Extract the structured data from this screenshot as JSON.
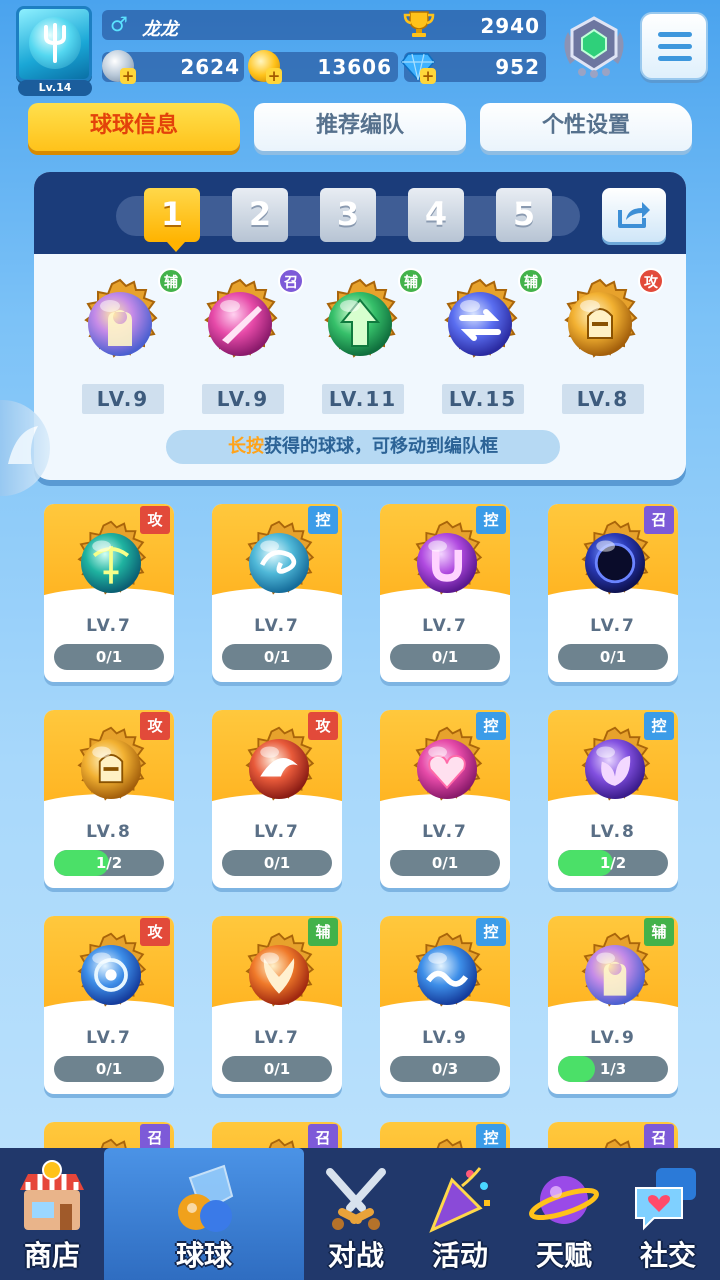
{
  "player": {
    "level": "Lv.14",
    "gender_symbol": "♂",
    "name": "龙龙",
    "trophies": "2940",
    "silver": "2624",
    "gold": "13606",
    "gems": "952"
  },
  "tabs": [
    "球球信息",
    "推荐编队",
    "个性设置"
  ],
  "team": {
    "slots": [
      "1",
      "2",
      "3",
      "4",
      "5"
    ],
    "selected_slot": "1",
    "balls": [
      {
        "level": "LV.9",
        "tag": "辅",
        "icon": "support-figure-ball"
      },
      {
        "level": "LV.9",
        "tag": "召",
        "icon": "pink-blade-ball"
      },
      {
        "level": "LV.11",
        "tag": "辅",
        "icon": "green-arrow-ball"
      },
      {
        "level": "LV.15",
        "tag": "辅",
        "icon": "blue-swap-ball"
      },
      {
        "level": "LV.8",
        "tag": "攻",
        "icon": "golden-knight-ball"
      }
    ],
    "hint_highlight": "长按",
    "hint_text": "获得的球球，可移动到编队框"
  },
  "cards": [
    {
      "level": "LV.7",
      "progress": "0/1",
      "fraction": 0,
      "tag": "攻",
      "icon": "green-crossbow-ball"
    },
    {
      "level": "LV.7",
      "progress": "0/1",
      "fraction": 0,
      "tag": "控",
      "icon": "cyan-swirl-ball"
    },
    {
      "level": "LV.7",
      "progress": "0/1",
      "fraction": 0,
      "tag": "控",
      "icon": "purple-magnet-ball"
    },
    {
      "level": "LV.7",
      "progress": "0/1",
      "fraction": 0,
      "tag": "召",
      "icon": "dark-portal-ball"
    },
    {
      "level": "LV.8",
      "progress": "1/2",
      "fraction": 0.5,
      "tag": "攻",
      "icon": "golden-knight-ball"
    },
    {
      "level": "LV.7",
      "progress": "0/1",
      "fraction": 0,
      "tag": "攻",
      "icon": "red-dolphin-ball"
    },
    {
      "level": "LV.7",
      "progress": "0/1",
      "fraction": 0,
      "tag": "控",
      "icon": "pink-heart-ball"
    },
    {
      "level": "LV.8",
      "progress": "1/2",
      "fraction": 0.5,
      "tag": "控",
      "icon": "purple-butterfly-ball"
    },
    {
      "level": "LV.7",
      "progress": "0/1",
      "fraction": 0,
      "tag": "攻",
      "icon": "blue-vortex-ball"
    },
    {
      "level": "LV.7",
      "progress": "0/1",
      "fraction": 0,
      "tag": "辅",
      "icon": "red-phoenix-ball"
    },
    {
      "level": "LV.9",
      "progress": "0/3",
      "fraction": 0,
      "tag": "控",
      "icon": "blue-wave-ball"
    },
    {
      "level": "LV.9",
      "progress": "1/3",
      "fraction": 0.333,
      "tag": "辅",
      "icon": "support-figure-ball"
    },
    {
      "level": "",
      "progress": "",
      "fraction": 0,
      "tag": "召",
      "icon": "partial-ball"
    },
    {
      "level": "",
      "progress": "",
      "fraction": 0,
      "tag": "召",
      "icon": "partial-ball"
    },
    {
      "level": "",
      "progress": "",
      "fraction": 0,
      "tag": "控",
      "icon": "partial-ball"
    },
    {
      "level": "",
      "progress": "",
      "fraction": 0,
      "tag": "召",
      "icon": "partial-ball"
    }
  ],
  "tag_colors": {
    "攻": "#e24a3a",
    "控": "#3b9ce8",
    "召": "#7d5ad8",
    "辅": "#43b24a"
  },
  "nav": [
    {
      "label": "商店",
      "icon": "shop-icon"
    },
    {
      "label": "球球",
      "icon": "balls-icon",
      "active": true
    },
    {
      "label": "对战",
      "icon": "battle-swords-icon"
    },
    {
      "label": "活动",
      "icon": "party-popper-icon"
    },
    {
      "label": "天赋",
      "icon": "planet-talent-icon"
    },
    {
      "label": "社交",
      "icon": "chat-heart-icon"
    }
  ]
}
